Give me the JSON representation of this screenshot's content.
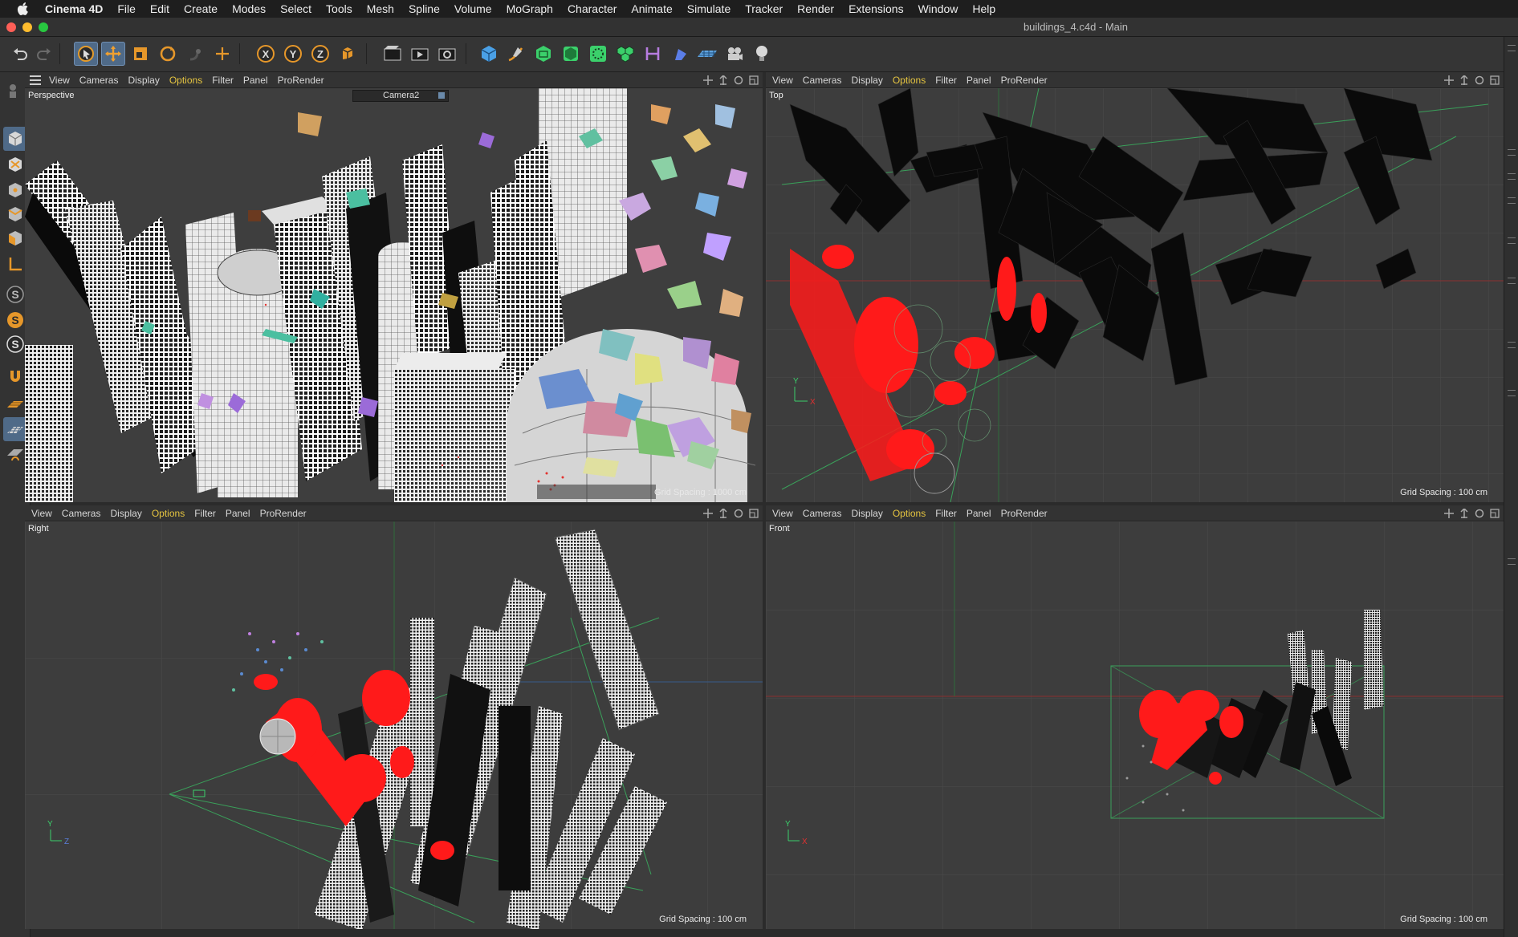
{
  "menubar": {
    "app_name": "Cinema 4D",
    "items": [
      "File",
      "Edit",
      "Create",
      "Modes",
      "Select",
      "Tools",
      "Mesh",
      "Spline",
      "Volume",
      "MoGraph",
      "Character",
      "Animate",
      "Simulate",
      "Tracker",
      "Render",
      "Extensions",
      "Window",
      "Help"
    ]
  },
  "window": {
    "title": "buildings_4.c4d - Main"
  },
  "viewport_menu": {
    "view": "View",
    "cameras": "Cameras",
    "display": "Display",
    "options": "Options",
    "filter": "Filter",
    "panel": "Panel",
    "prorender": "ProRender"
  },
  "viewports": {
    "perspective": {
      "label": "Perspective",
      "camera": "Camera2",
      "grid_spacing": "Grid Spacing : 1000 cm"
    },
    "top": {
      "label": "Top",
      "grid_spacing": "Grid Spacing : 100 cm"
    },
    "right": {
      "label": "Right",
      "grid_spacing": "Grid Spacing : 100 cm"
    },
    "front": {
      "label": "Front",
      "grid_spacing": "Grid Spacing : 100 cm"
    }
  },
  "axis_labels": {
    "x": "X",
    "y": "Y",
    "z": "Z"
  },
  "toolbar_icons": [
    "undo-icon",
    "redo-icon",
    "live-select-icon",
    "move-icon",
    "scale-icon",
    "rotate-icon",
    "recent-tools-icon",
    "world-axis-icon",
    "x-lock-icon",
    "y-lock-icon",
    "z-lock-icon",
    "coordinate-system-icon",
    "render-view-icon",
    "render-to-picture-viewer-icon",
    "render-settings-icon",
    "cube-icon",
    "pen-icon",
    "subdivision-icon",
    "extrude-icon",
    "cloner-icon",
    "array-icon",
    "deformer-icon",
    "spline-wrap-icon",
    "floor-icon",
    "camera-icon",
    "light-icon"
  ],
  "left_tool_icons": [
    "model-mode-icon",
    "texture-mode-icon",
    "points-mode-icon",
    "edges-mode-icon",
    "polygons-mode-icon",
    "uv-mode-icon",
    "axis-mode-icon",
    "snap-icon",
    "snap-settings-icon",
    "workplane-icon",
    "magnet-icon",
    "grid-icon",
    "lock-icon",
    "solo-icon"
  ],
  "colors": {
    "selection_red": "#ff1a1a",
    "options_yellow": "#e5c440",
    "active_blue": "#4f6a88"
  }
}
